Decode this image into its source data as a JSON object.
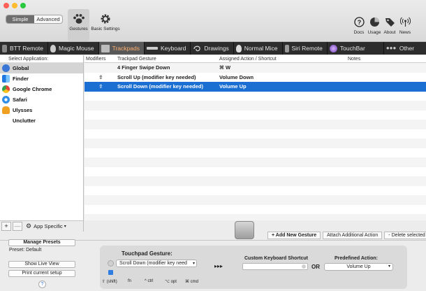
{
  "window": {
    "traffic_colors": [
      "#fe5f57",
      "#febc2e",
      "#28c840"
    ]
  },
  "header": {
    "mode_simple": "Simple",
    "mode_advanced": "Advanced",
    "gestures_label": "Gestures",
    "basic_settings_label": "Basic Settings",
    "right_buttons": [
      {
        "label": "Docs",
        "icon": "help-icon"
      },
      {
        "label": "Usage",
        "icon": "pie-chart-icon"
      },
      {
        "label": "About",
        "icon": "tag-icon"
      },
      {
        "label": "News",
        "icon": "broadcast-icon"
      }
    ]
  },
  "tabs": [
    {
      "label": "BTT Remote",
      "icon": "remote-icon"
    },
    {
      "label": "Magic Mouse",
      "icon": "mouse-icon"
    },
    {
      "label": "Trackpads",
      "icon": "trackpad-icon",
      "selected": true
    },
    {
      "label": "Keyboard",
      "icon": "keyboard-icon"
    },
    {
      "label": "Drawings",
      "icon": "drawing-icon"
    },
    {
      "label": "Normal Mice",
      "icon": "mouse-icon"
    },
    {
      "label": "Siri Remote",
      "icon": "remote-icon"
    },
    {
      "label": "TouchBar",
      "icon": "touchbar-icon"
    },
    {
      "label": "Other",
      "icon": "dots-icon"
    }
  ],
  "sidebar": {
    "header": "Select Application:",
    "apps": [
      {
        "name": "Global",
        "color": "#3a77d6"
      },
      {
        "name": "Finder",
        "color": "#3b9af0"
      },
      {
        "name": "Google Chrome",
        "color": "#e2463a"
      },
      {
        "name": "Safari",
        "color": "#2f8fe8"
      },
      {
        "name": "Ulysses",
        "color": "#f0a020"
      },
      {
        "name": "Unclutter",
        "color": ""
      }
    ],
    "add": "+",
    "remove": "—",
    "specific": "App Specific"
  },
  "table": {
    "headers": [
      "Modifiers",
      "Trackpad Gesture",
      "Assigned Action / Shortcut",
      "Notes"
    ],
    "rows": [
      {
        "modifiers": "",
        "gesture": "4 Finger Swipe Down",
        "action": "⌘ W",
        "notes": ""
      },
      {
        "modifiers": "⇧",
        "gesture": "Scroll Up (modifier key needed)",
        "action": "Volume Down",
        "notes": ""
      },
      {
        "modifiers": "⇧",
        "gesture": "Scroll Down (modifier key needed)",
        "action": "Volume Up",
        "notes": ""
      }
    ],
    "selected_row": 2
  },
  "toolbar": {
    "add_new": "+ Add New Gesture",
    "attach": "Attach Additional Action",
    "delete": "- Delete selected"
  },
  "left_panel": {
    "manage_presets": "Manage Presets",
    "preset": "Preset: Default",
    "show_live_view": "Show Live View",
    "print_setup": "Print current setup",
    "help": "?"
  },
  "gesture_panel": {
    "title": "Touchpad Gesture:",
    "selected": "Scroll Down (modifier key need",
    "arrows": "▸▸▸",
    "keyboard_label": "Custom Keyboard Shortcut",
    "or": "OR",
    "predefined_label": "Predefined Action:",
    "predefined_value": "Volume Up",
    "modifiers": [
      "⇧ (shift)",
      "fn",
      "^ ctrl",
      "⌥ opt",
      "⌘ cmd"
    ]
  }
}
